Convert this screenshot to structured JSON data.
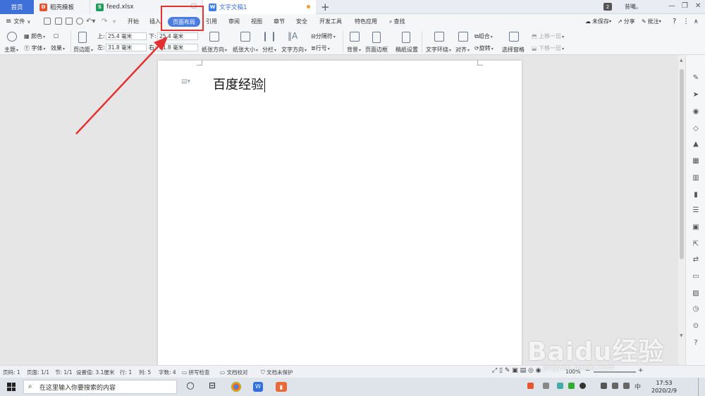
{
  "tabs": [
    {
      "label": "首页"
    },
    {
      "label": "稻壳模板"
    },
    {
      "label": "feed.xlsx"
    },
    {
      "label": "文字文稿1"
    }
  ],
  "tab_count_badge": "2",
  "user_name": "昔曦。",
  "menu": {
    "file": "文件",
    "items": [
      "开始",
      "插入",
      "页面布局",
      "引用",
      "审阅",
      "视图",
      "章节",
      "安全",
      "开发工具",
      "特色应用"
    ],
    "search": "查找",
    "right": [
      "未保存",
      "分享",
      "批注"
    ]
  },
  "ribbon": {
    "theme": "主题",
    "color": "颜色",
    "font": "字体",
    "effect": "效果",
    "margin": "页边距",
    "top_label": "上:",
    "top_value": "25.4 毫米",
    "bottom_label": "下:",
    "bottom_value": "25.4 毫米",
    "left_label": "左:",
    "left_value": "31.8 毫米",
    "right_label": "右:",
    "right_value": "31.8 毫米",
    "orientation": "纸张方向",
    "size": "纸张大小",
    "columns": "分栏",
    "text_direction": "文字方向",
    "separator": "分隔符",
    "line_number": "行号",
    "background": "背景",
    "page_border": "页面边框",
    "manuscript": "稿纸设置",
    "wrap": "文字环绕",
    "align": "对齐",
    "group": "组合",
    "rotate": "旋转",
    "selection_pane": "选择窗格",
    "bring_forward": "上移一层",
    "send_backward": "下移一层"
  },
  "document": {
    "text": "百度经验"
  },
  "status": {
    "page": "页码: 1",
    "pages": "页面: 1/1",
    "section": "节: 1/1",
    "setting": "设置值: 3.1厘米",
    "row": "行: 1",
    "col": "列: 5",
    "words": "字数: 4",
    "spell": "拼写检查",
    "proof": "文档校对",
    "protect": "文档未保护",
    "zoom": "100%"
  },
  "taskbar": {
    "search_placeholder": "在这里输入你要搜索的内容",
    "time": "17:53",
    "date": "2020/2/9",
    "ime": "中"
  },
  "watermark": {
    "brand": "Baidu经验",
    "url": "jingyan.baidu.com"
  }
}
